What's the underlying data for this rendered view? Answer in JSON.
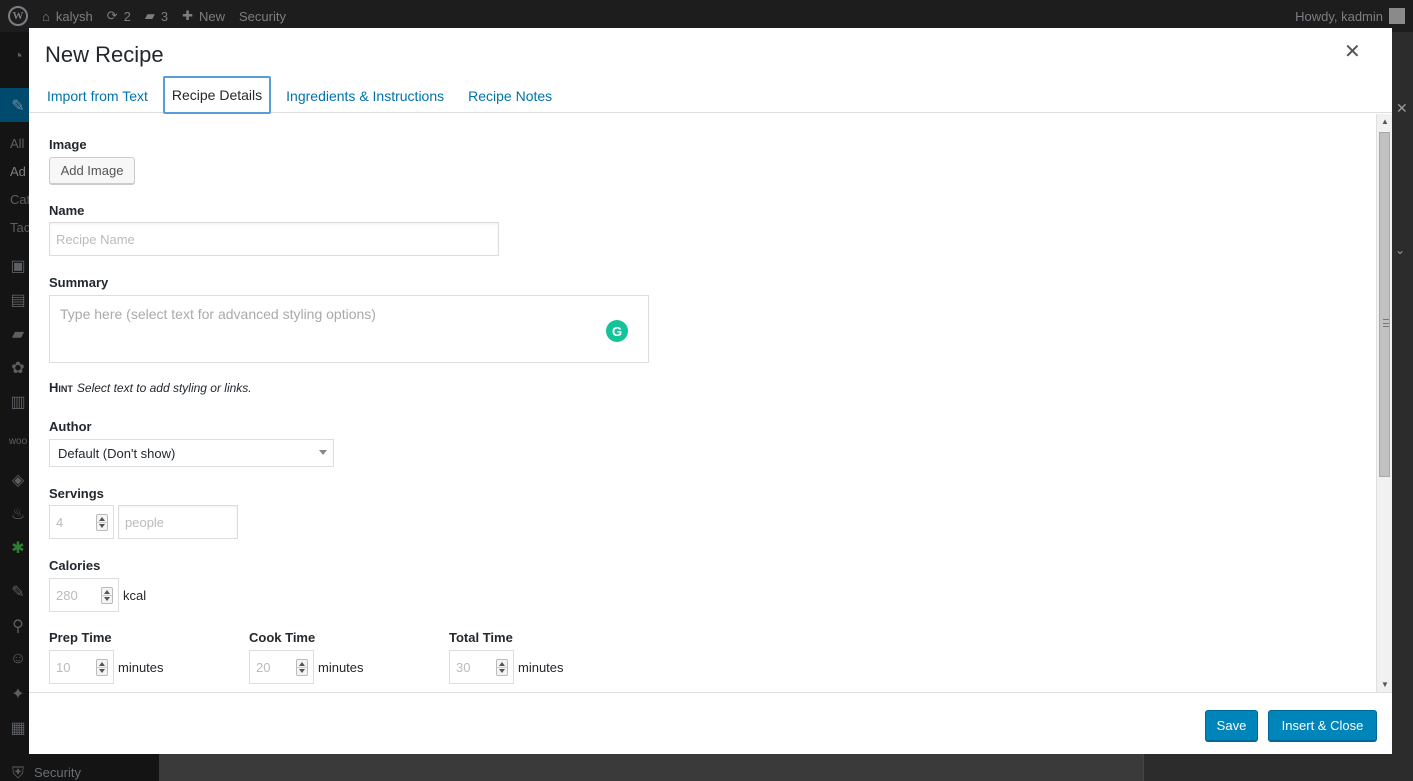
{
  "adminbar": {
    "site_name": "kalysh",
    "updates_count": "2",
    "comments_count": "3",
    "new_label": "New",
    "security_label": "Security",
    "howdy": "Howdy, kadmin"
  },
  "adminmenu": {
    "sub_items": [
      "All",
      "Ad",
      "Cat",
      "Tac"
    ],
    "security_label": "Security"
  },
  "modal": {
    "title": "New Recipe",
    "close_icon": "close-icon",
    "tabs": [
      {
        "label": "Import from Text"
      },
      {
        "label": "Recipe Details"
      },
      {
        "label": "Ingredients & Instructions"
      },
      {
        "label": "Recipe Notes"
      }
    ],
    "active_tab": "Recipe Details"
  },
  "form": {
    "image": {
      "label": "Image",
      "button": "Add Image"
    },
    "name": {
      "label": "Name",
      "placeholder": "Recipe Name"
    },
    "summary": {
      "label": "Summary",
      "placeholder": "Type here (select text for advanced styling options)"
    },
    "hint": {
      "label": "Hint",
      "text": "Select text to add styling or links."
    },
    "author": {
      "label": "Author",
      "selected": "Default (Don't show)"
    },
    "servings": {
      "label": "Servings",
      "value": "4",
      "unit_placeholder": "people"
    },
    "calories": {
      "label": "Calories",
      "value": "280",
      "unit": "kcal"
    },
    "prep_time": {
      "label": "Prep Time",
      "value": "10",
      "unit": "minutes"
    },
    "cook_time": {
      "label": "Cook Time",
      "value": "20",
      "unit": "minutes"
    },
    "total_time": {
      "label": "Total Time",
      "value": "30",
      "unit": "minutes"
    }
  },
  "footer": {
    "save": "Save",
    "insert_close": "Insert & Close"
  },
  "colors": {
    "primary": "#0085ba",
    "link": "#0073aa",
    "active_tab_border": "#5b9dd9",
    "grammarly": "#15c39a"
  }
}
